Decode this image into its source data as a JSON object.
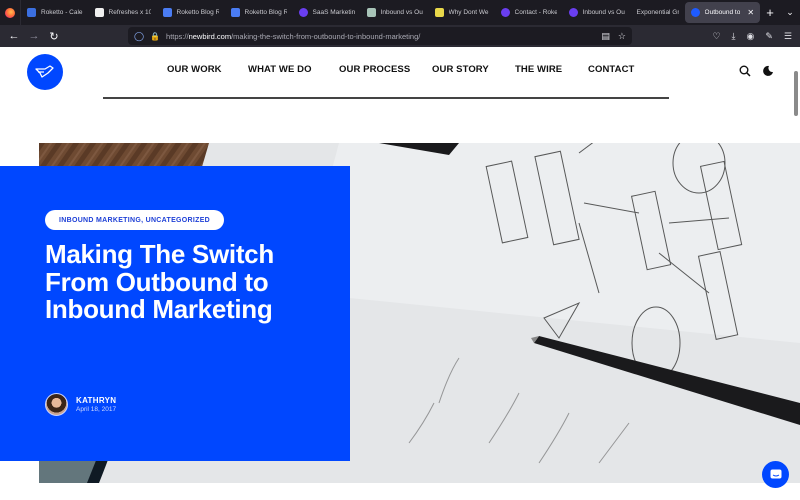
{
  "browser": {
    "tabs": [
      {
        "label": "Roketto - Cale",
        "favicon": "calendar-icon",
        "color": "#3b6fe0"
      },
      {
        "label": "Refreshes x 10",
        "favicon": "sheets-icon",
        "color": "#f0f0f0"
      },
      {
        "label": "Roketto Blog R",
        "favicon": "docs-icon",
        "color": "#4a7cf3"
      },
      {
        "label": "Roketto Blog R",
        "favicon": "docs-icon",
        "color": "#4a7cf3"
      },
      {
        "label": "SaaS Marketin",
        "favicon": "heart-icon",
        "color": "#6a3ef0"
      },
      {
        "label": "Inbound vs Ou",
        "favicon": "generic-icon",
        "color": "#a8c4b8"
      },
      {
        "label": "Why Dont We",
        "favicon": "file-icon",
        "color": "#e8d84a"
      },
      {
        "label": "Contact - Roke",
        "favicon": "heart-icon",
        "color": "#6a3ef0"
      },
      {
        "label": "Inbound vs Ou",
        "favicon": "heart-icon",
        "color": "#6a3ef0"
      },
      {
        "label": "Exponential Growt",
        "favicon": "",
        "color": ""
      },
      {
        "label": "Outbound to",
        "favicon": "newbird-icon",
        "color": "#1e5bff",
        "active": true
      }
    ],
    "url_prefix": "https://",
    "url_domain": "newbird.com",
    "url_path": "/making-the-switch-from-outbound-to-inbound-marketing/"
  },
  "site": {
    "brand_color": "#0047ff",
    "nav": [
      "OUR WORK",
      "WHAT WE DO",
      "OUR PROCESS",
      "OUR STORY",
      "THE WIRE",
      "CONTACT"
    ]
  },
  "post": {
    "categories": "INBOUND MARKETING, UNCATEGORIZED",
    "title": "Making The Switch From Outbound to Inbound Marketing",
    "author": "KATHRYN",
    "date": "April 18, 2017"
  }
}
